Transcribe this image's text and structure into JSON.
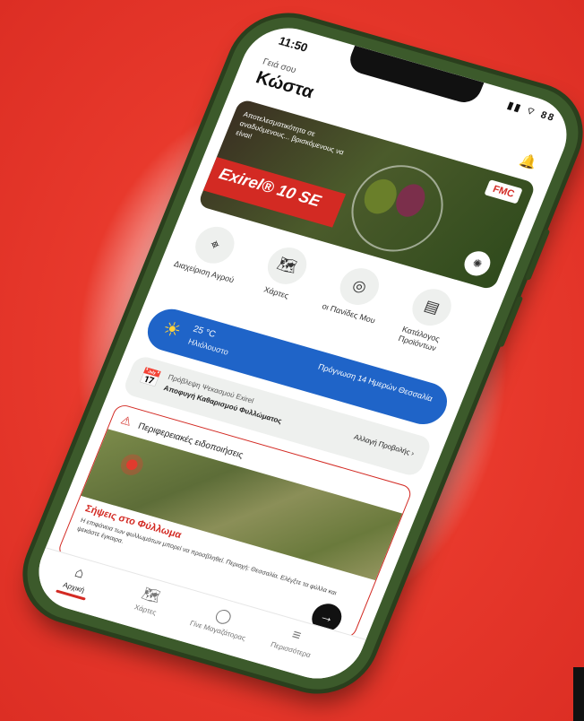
{
  "status": {
    "time": "11:50",
    "icons": "▮▮ ⌔ 88"
  },
  "header": {
    "greeting": "Γειά σου",
    "name": "Κώστα"
  },
  "banner": {
    "tagline": "Αποτελεσματικότητα σε αναδυόμενους... βρισκόμενους να είναι!",
    "product": "Exirel® 10 SE",
    "brand": "FMC"
  },
  "quick_actions": [
    {
      "label": "Διαχείριση Αγρού",
      "icon": "field-scan-icon"
    },
    {
      "label": "Χάρτες",
      "icon": "map-icon"
    },
    {
      "label": "οι Πανίδες Μου",
      "icon": "target-icon"
    },
    {
      "label": "Κατάλογος Προϊόντων",
      "icon": "catalog-icon"
    }
  ],
  "weather": {
    "temp": "25 °C",
    "condition": "Ηλιόλουστο",
    "forecast": "Πρόγνωση 14 Ημερών Θεσσαλία"
  },
  "reminder": {
    "line1": "Πρόβλεψη Ψεκασμού Exirel",
    "line2": "Αποφυγή Καθαρισμού Φυλλώματος",
    "action": "Αλλαγή Προβολής ›"
  },
  "alerts": {
    "title": "Περιφερειακές ειδοποιήσεις",
    "alert_title": "Σήψεις στο Φύλλωμα",
    "alert_desc": "Η επιφάνεια των φυλλωμάτων μπορεί να προσβληθεί. Περιοχή: Θεσσαλία. Ελέγξτε τα φύλλα και ψεκάστε έγκαιρα."
  },
  "tabs": [
    {
      "label": "Αρχική",
      "icon": "home-icon"
    },
    {
      "label": "Χάρτες",
      "icon": "map-icon"
    },
    {
      "label": "Γίνε Μαγαζάτορας",
      "icon": "chat-icon"
    },
    {
      "label": "Περισσότερα",
      "icon": "menu-icon"
    }
  ],
  "colors": {
    "accent": "#d32a23",
    "weather_bg": "#1f64c8",
    "phone_frame": "#3c5a2b"
  }
}
